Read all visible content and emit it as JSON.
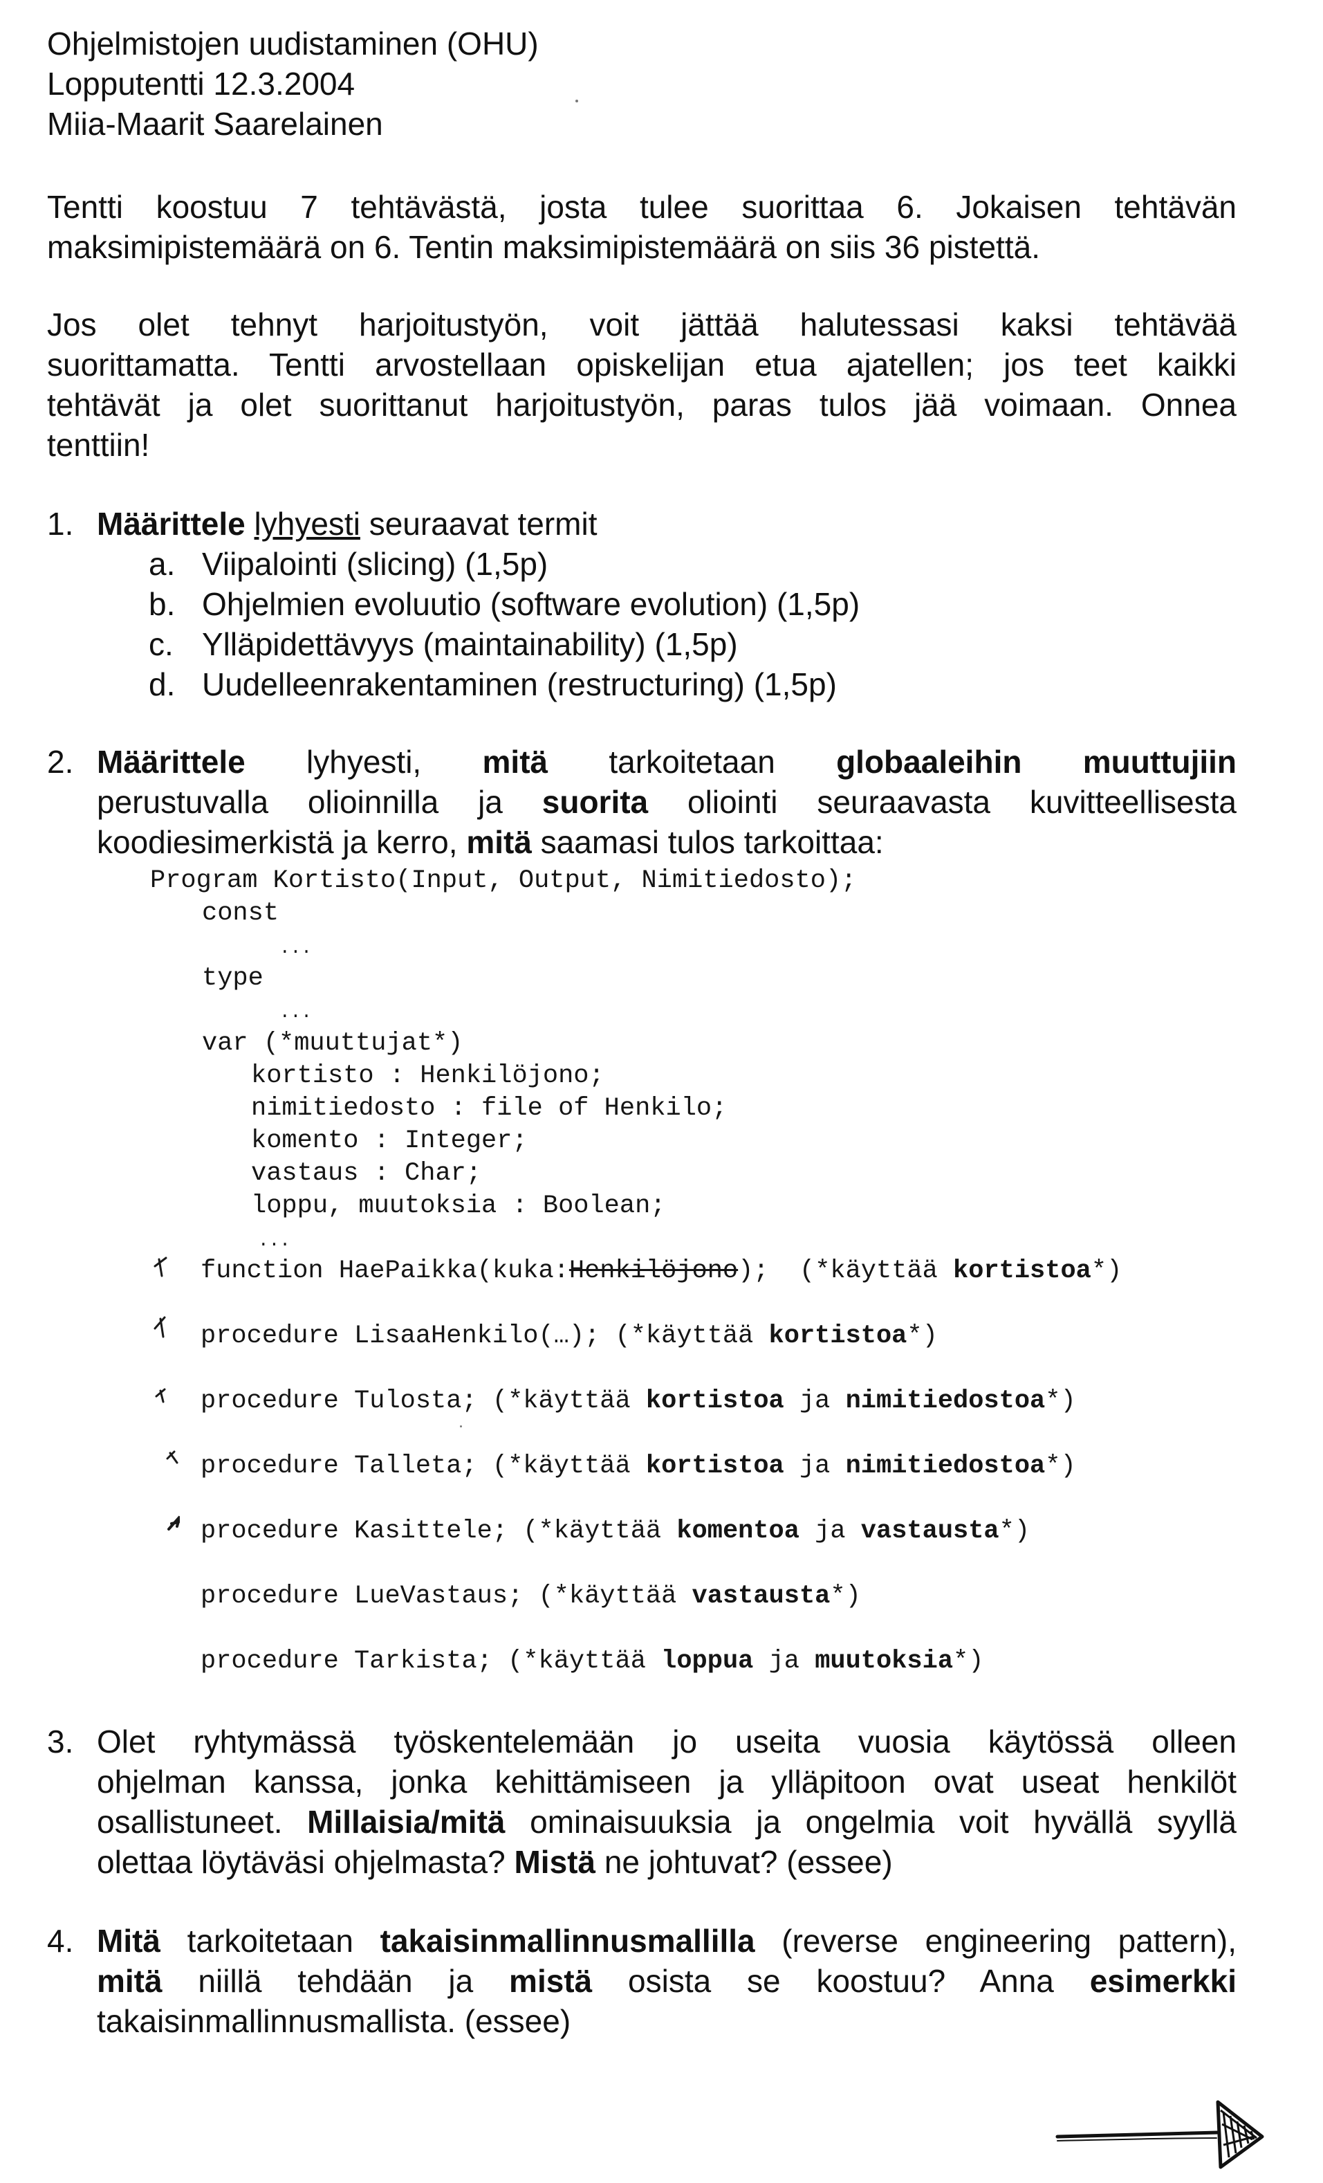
{
  "header": {
    "course": "Ohjelmistojen uudistaminen (OHU)",
    "exam": "Lopputentti 12.3.2004",
    "teacher": "Miia-Maarit Saarelainen"
  },
  "intro": {
    "p1": [
      "Tentti koostuu 7 tehtävästä, josta tulee suorittaa 6. Jokaisen tehtävän",
      "maksimipistemäärä on 6. Tentin maksimipistemäärä on siis 36 pistettä."
    ],
    "p2": [
      "Jos olet tehnyt harjoitustyön, voit jättää halutessasi kaksi tehtävää",
      "suorittamatta. Tentti arvostellaan opiskelijan etua ajatellen; jos teet kaikki",
      "tehtävät ja olet suorittanut harjoitustyön, paras tulos jää voimaan. Onnea",
      "tenttiin!"
    ]
  },
  "q1": {
    "num": "1.",
    "bold": "Määrittele",
    "underlined": "lyhyesti",
    "rest": " seuraavat termit",
    "items": [
      {
        "letter": "a.",
        "text": "Viipalointi (slicing) (1,5p)"
      },
      {
        "letter": "b.",
        "text": "Ohjelmien evoluutio (software evolution) (1,5p)"
      },
      {
        "letter": "c.",
        "text": "Ylläpidettävyys (maintainability) (1,5p)"
      },
      {
        "letter": "d.",
        "text": "Uudelleenrakentaminen (restructuring) (1,5p)"
      }
    ]
  },
  "q2": {
    "num": "2.",
    "l1": [
      "Määrittele",
      " lyhyesti, ",
      "mitä",
      " tarkoitetaan ",
      "globaaleihin muuttujiin"
    ],
    "l2": [
      "perustuvalla olioinnilla ja ",
      "suorita",
      " oliointi seuraavasta kuvitteellisesta"
    ],
    "l3": [
      "koodiesimerkistä ja kerro, ",
      "mitä",
      " saamasi tulos tarkoittaa:"
    ],
    "code": {
      "program": "Program Kortisto(Input, Output, Nimitiedosto);",
      "const": "const",
      "ellipsis": "...",
      "type": "type",
      "var": "var (*muuttujat*)",
      "vars": [
        "kortisto : Henkilöjono;",
        "nimitiedosto : file of Henkilo;",
        "komento : Integer;",
        "vastaus : Char;",
        "loppu, muutoksia : Boolean;"
      ],
      "routines": [
        {
          "decl": "function HaePaikka(kuka:",
          "struck": "Henkilöjono",
          "tail": "); ",
          "comment_pre": "(*käyttää ",
          "b1": "kortistoa",
          "mid": "",
          "b2": "",
          "comment_post": "*)"
        },
        {
          "decl": "procedure LisaaHenkilo(…); ",
          "struck": "",
          "tail": "",
          "comment_pre": "(*käyttää ",
          "b1": "kortistoa",
          "mid": "",
          "b2": "",
          "comment_post": "*)"
        },
        {
          "decl": "procedure Tulosta; ",
          "struck": "",
          "tail": "",
          "comment_pre": "(*käyttää ",
          "b1": "kortistoa",
          "mid": " ja ",
          "b2": "nimitiedostoa",
          "comment_post": "*)"
        },
        {
          "decl": "procedure Talleta; ",
          "struck": "",
          "tail": "",
          "comment_pre": "(*käyttää ",
          "b1": "kortistoa",
          "mid": " ja ",
          "b2": "nimitiedostoa",
          "comment_post": "*)"
        },
        {
          "decl": "procedure Kasittele; ",
          "struck": "",
          "tail": "",
          "comment_pre": "(*käyttää ",
          "b1": "komentoa",
          "mid": " ja ",
          "b2": "vastausta",
          "comment_post": "*)"
        },
        {
          "decl": "procedure LueVastaus; ",
          "struck": "",
          "tail": "",
          "comment_pre": "(*käyttää ",
          "b1": "vastausta",
          "mid": "",
          "b2": "",
          "comment_post": "*)"
        },
        {
          "decl": "procedure Tarkista; ",
          "struck": "",
          "tail": "",
          "comment_pre": "(*käyttää ",
          "b1": "loppua",
          "mid": " ja ",
          "b2": "muutoksia",
          "comment_post": "*)"
        }
      ]
    }
  },
  "q3": {
    "num": "3.",
    "l1": "Olet ryhtymässä työskentelemään jo useita vuosia käytössä olleen",
    "l2": "ohjelman kanssa, jonka kehittämiseen ja ylläpitoon ovat useat henkilöt",
    "l3": [
      "osallistuneet. ",
      "Millaisia/mitä",
      " ominaisuuksia ja ongelmia voit hyvällä syyllä"
    ],
    "l4": [
      "olettaa löytäväsi ohjelmasta? ",
      "Mistä",
      " ne johtuvat? (essee)"
    ]
  },
  "q4": {
    "num": "4.",
    "l1": [
      "Mitä",
      " tarkoitetaan ",
      "takaisinmallinnusmallilla",
      " (reverse engineering pattern),"
    ],
    "l2": [
      "mitä",
      " niillä tehdään ja ",
      "mistä",
      " osista se koostuu? Anna ",
      "esimerkki"
    ],
    "l3": "takaisinmallinnusmallista. (essee)"
  }
}
